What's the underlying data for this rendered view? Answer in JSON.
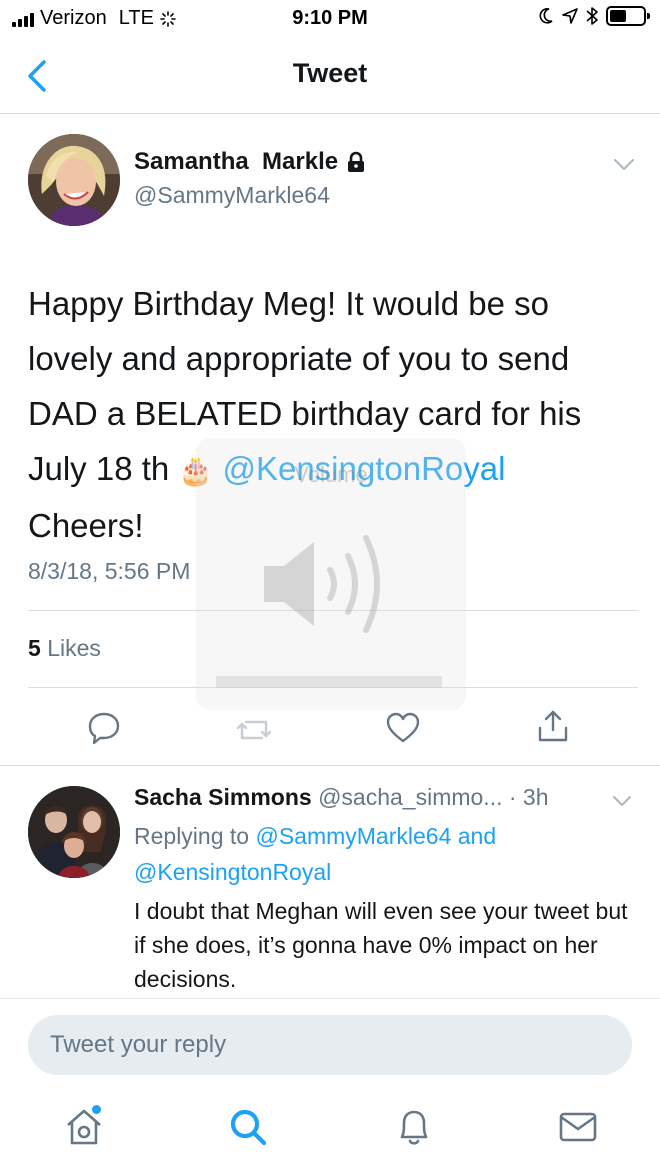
{
  "status_bar": {
    "carrier": "Verizon",
    "network": "LTE",
    "time": "9:10 PM"
  },
  "nav": {
    "title": "Tweet"
  },
  "tweet": {
    "author_name": "Samantha  Markle",
    "author_handle": "@SammyMarkle64",
    "text_before_emoji": "Happy Birthday Meg! It would be so lovely and appropriate of you to send DAD a BELATED birthday card for his July 18 th ",
    "emoji": "🎂",
    "mention": "@KensingtonRoyal",
    "text_after_mention": "Cheers!",
    "timestamp": "8/3/18, 5:56 PM",
    "likes_count": "5",
    "likes_label": "Likes"
  },
  "volume_hud": {
    "label": "Volume"
  },
  "reply": {
    "author_name": "Sacha Simmons",
    "author_handle": "@sacha_simmo...",
    "time": "· 3h",
    "replying_to_prefix": "Replying to ",
    "replying_to_mention_1": "@SammyMarkle64",
    "replying_to_and": " and",
    "replying_to_mention_2": "@KensingtonRoyal",
    "text": "I doubt that Meghan will even see your tweet but if she does, it’s gonna have 0% impact on her decisions."
  },
  "composer": {
    "placeholder": "Tweet your reply"
  },
  "colors": {
    "accent": "#1da1f2",
    "secondary_text": "#657786",
    "divider": "#d8dde1"
  },
  "icons": [
    "back-icon",
    "lock-icon",
    "chevron-down-icon",
    "reply-icon",
    "retweet-icon",
    "like-icon",
    "share-icon",
    "home-icon",
    "search-icon",
    "notifications-icon",
    "messages-icon"
  ]
}
